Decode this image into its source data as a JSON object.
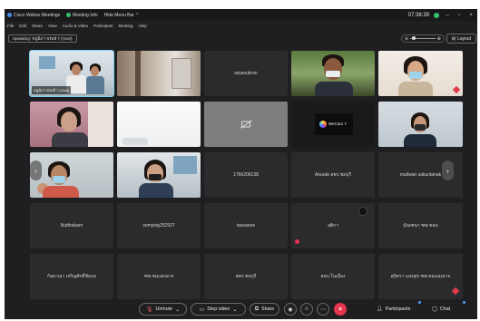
{
  "titlebar": {
    "app_name": "Cisco Webex Meetings",
    "meeting_info": "Meeting Info",
    "hide_menu": "Hide Menu Bar",
    "clock": "07:38:39"
  },
  "menu": [
    "File",
    "Edit",
    "Share",
    "View",
    "Audio & Video",
    "Participant",
    "Meeting",
    "Help"
  ],
  "infobar": {
    "speaking": "Speaking: หนูนิภา พรมลี 7 (Host)",
    "layout_label": "Layout"
  },
  "tiles": [
    {
      "id": "t1",
      "type": "video",
      "label": "หนูนิภา พรมลี 7 (Host)",
      "active": true
    },
    {
      "id": "t2",
      "type": "video"
    },
    {
      "id": "t3",
      "type": "name",
      "name": "wisanukron"
    },
    {
      "id": "t4",
      "type": "video"
    },
    {
      "id": "t5",
      "type": "video"
    },
    {
      "id": "t6",
      "type": "video"
    },
    {
      "id": "t7",
      "type": "video"
    },
    {
      "id": "t8",
      "type": "camoff"
    },
    {
      "id": "t9",
      "type": "video",
      "overlay": "WeCam 7"
    },
    {
      "id": "t10",
      "type": "video"
    },
    {
      "id": "t11",
      "type": "video"
    },
    {
      "id": "t12",
      "type": "video"
    },
    {
      "id": "t13",
      "type": "name",
      "name": "1766206138"
    },
    {
      "id": "t14",
      "type": "name",
      "name": "Anurak สพร.ชลบุรี"
    },
    {
      "id": "t15",
      "type": "name",
      "name": "maliwan sakuntanak"
    },
    {
      "id": "t16",
      "type": "name",
      "name": "Nutthakarn"
    },
    {
      "id": "t17",
      "type": "name",
      "name": "somying252927"
    },
    {
      "id": "t18",
      "type": "name",
      "name": "tassanee"
    },
    {
      "id": "t19",
      "type": "name",
      "name": "จุติกา"
    },
    {
      "id": "t20",
      "type": "name",
      "name": "มัณฑนา ฑพ.ชลบ"
    },
    {
      "id": "t21",
      "type": "name",
      "name": "กัลยาณา เจริญศักดิ์ชัยกุล"
    },
    {
      "id": "t22",
      "type": "name",
      "name": "ฑพ.ชมแสงอาจ"
    },
    {
      "id": "t23",
      "type": "name",
      "name": "สพร.ชลบุรี"
    },
    {
      "id": "t24",
      "type": "name",
      "name": "สอบ.ในเมือง"
    },
    {
      "id": "t25",
      "type": "name",
      "name": "สุจิตรา แสงสุข ฑพ.ชมแสงอาจ"
    }
  ],
  "toolbar": {
    "unmute": "Unmute",
    "stop_video": "Stop video",
    "share": "Share",
    "participants": "Participants",
    "chat": "Chat"
  },
  "colors": {
    "background": "#1f1f21",
    "tile": "#2b2b2d",
    "active_border": "#7ad2f0",
    "end_button": "#e6344d",
    "muted": "#ff5a6b"
  }
}
